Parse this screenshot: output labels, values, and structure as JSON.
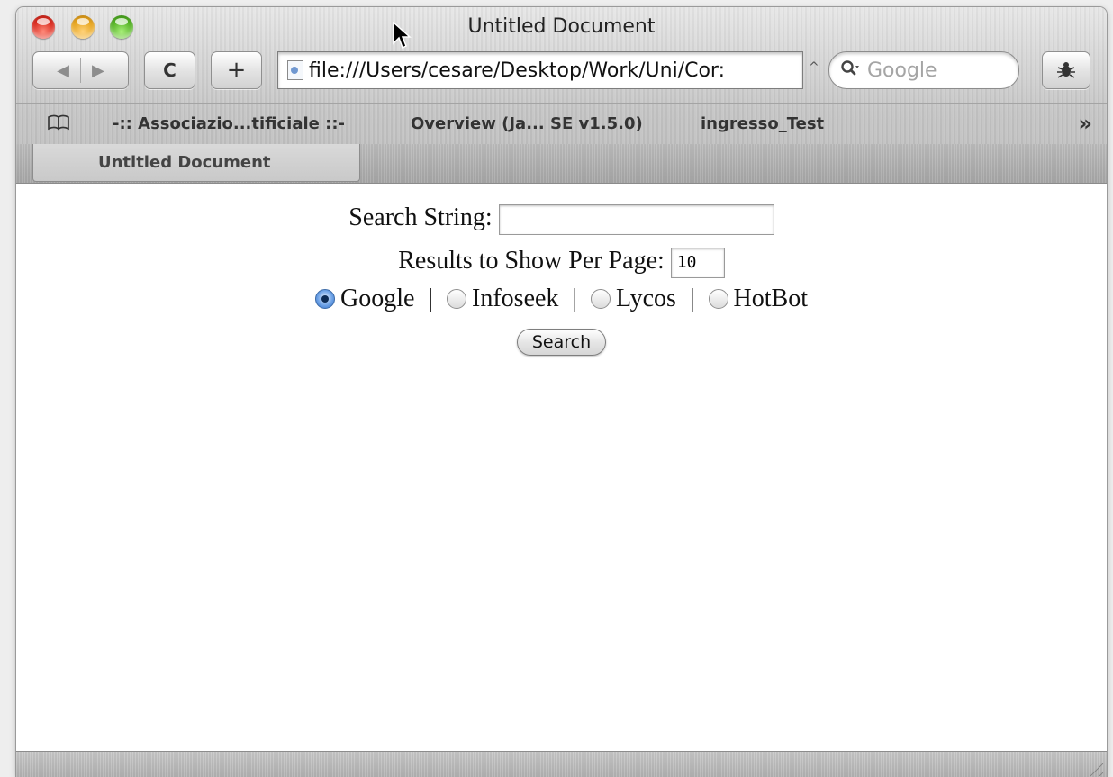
{
  "window": {
    "title": "Untitled Document"
  },
  "toolbar": {
    "back_icon": "◀",
    "forward_icon": "▶",
    "reload_label": "C",
    "add_bookmark_label": "+",
    "address_url": "file:///Users/cesare/Desktop/Work/Uni/Cor:",
    "search_placeholder": "Google",
    "snapback_glyph": "^"
  },
  "bookmarks": {
    "items": [
      {
        "label": "-:: Associazio...tificiale ::-"
      },
      {
        "label": "Overview (Ja... SE v1.5.0)"
      },
      {
        "label": "ingresso_Test"
      }
    ],
    "more_glyph": "»"
  },
  "tabs": [
    {
      "label": "Untitled Document",
      "active": true
    }
  ],
  "form": {
    "search_label": "Search String:",
    "search_value": "",
    "results_label": "Results to Show Per Page:",
    "results_value": "10",
    "engines": [
      {
        "label": "Google",
        "selected": true
      },
      {
        "label": "Infoseek",
        "selected": false
      },
      {
        "label": "Lycos",
        "selected": false
      },
      {
        "label": "HotBot",
        "selected": false
      }
    ],
    "separator": "|",
    "submit_label": "Search"
  }
}
